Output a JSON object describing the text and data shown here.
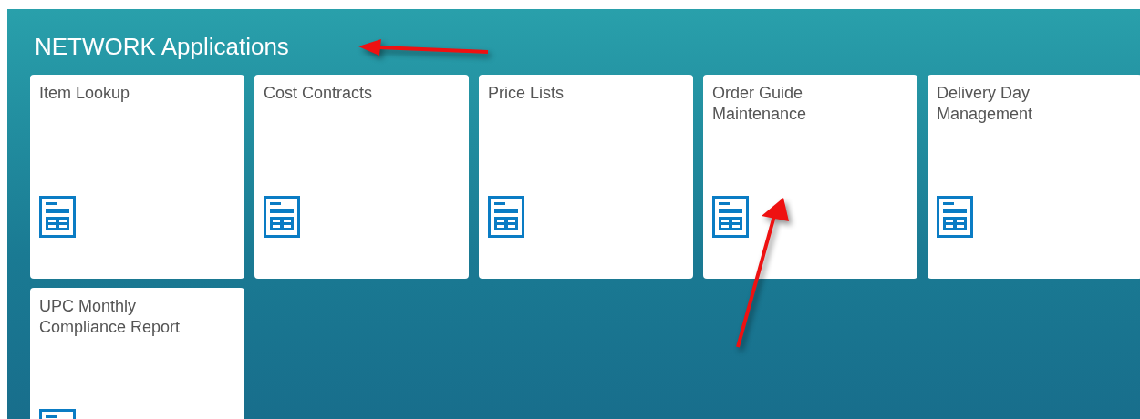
{
  "group": {
    "title": "NETWORK Applications"
  },
  "tiles": [
    {
      "title": "Item Lookup"
    },
    {
      "title": "Cost Contracts"
    },
    {
      "title": "Price Lists"
    },
    {
      "title": "Order Guide\nMaintenance"
    },
    {
      "title": "Delivery Day\nManagement"
    },
    {
      "title": "UPC Monthly\nCompliance Report"
    }
  ]
}
